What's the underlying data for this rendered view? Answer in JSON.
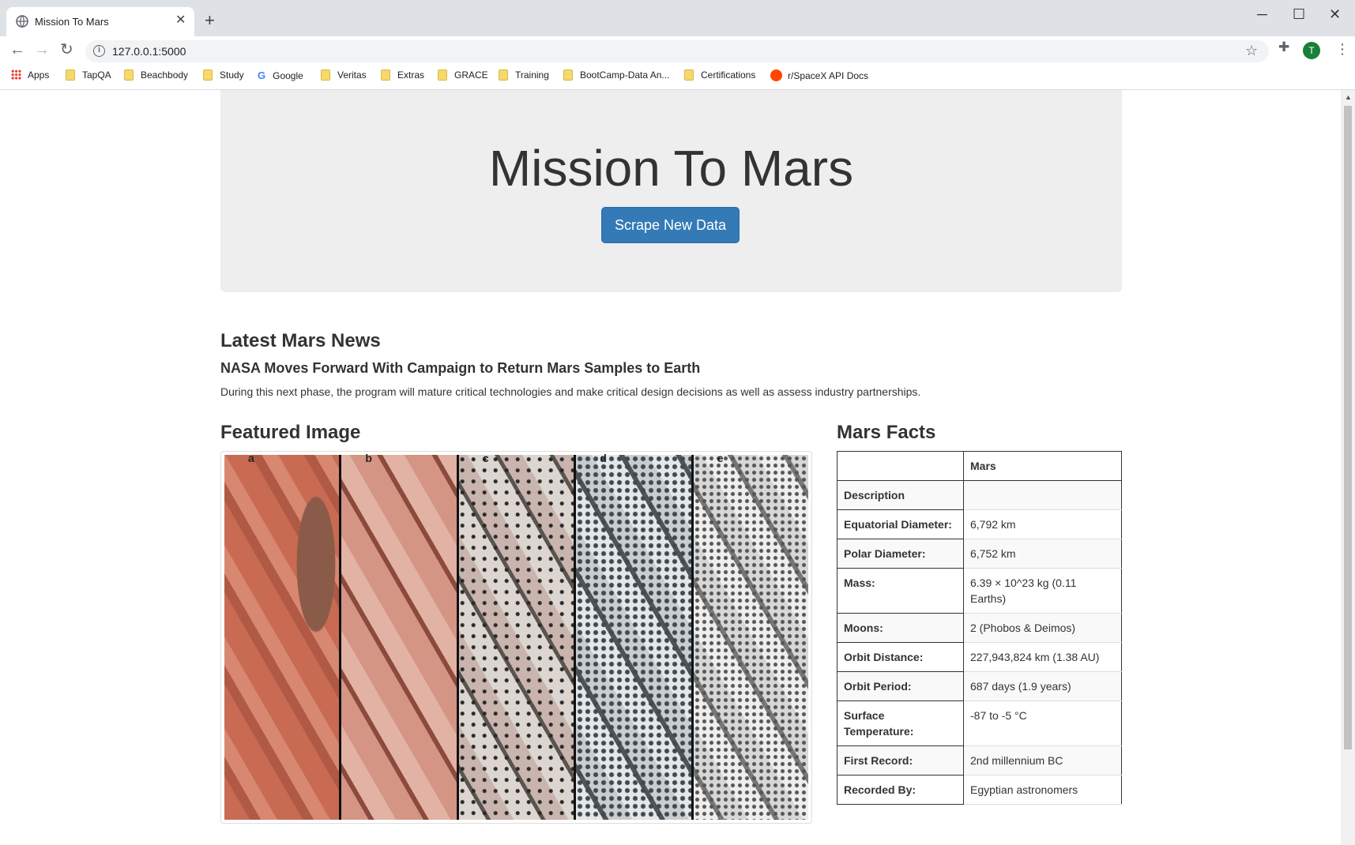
{
  "browser": {
    "tab_title": "Mission To Mars",
    "url": "127.0.0.1:5000",
    "avatar_letter": "T",
    "bookmarks": [
      {
        "label": "Apps",
        "icon": "apps-grid-icon"
      },
      {
        "label": "TapQA",
        "icon": "folder-icon"
      },
      {
        "label": "Beachbody",
        "icon": "folder-icon"
      },
      {
        "label": "Study",
        "icon": "folder-icon"
      },
      {
        "label": "Google",
        "icon": "google-icon"
      },
      {
        "label": "Veritas",
        "icon": "folder-icon"
      },
      {
        "label": "Extras",
        "icon": "folder-icon"
      },
      {
        "label": "GRACE",
        "icon": "folder-icon"
      },
      {
        "label": "Training",
        "icon": "folder-icon"
      },
      {
        "label": "BootCamp-Data An...",
        "icon": "folder-icon"
      },
      {
        "label": "Certifications",
        "icon": "folder-icon"
      },
      {
        "label": "r/SpaceX API Docs",
        "icon": "reddit-icon"
      }
    ]
  },
  "page": {
    "title": "Mission To Mars",
    "scrape_button": "Scrape New Data",
    "news": {
      "heading": "Latest Mars News",
      "title": "NASA Moves Forward With Campaign to Return Mars Samples to Earth",
      "paragraph": "During this next phase, the program will mature critical technologies and make critical design decisions as well as assess industry partnerships."
    },
    "featured_image": {
      "heading": "Featured Image",
      "panel_labels": [
        "a",
        "b",
        "c",
        "d",
        "e"
      ]
    },
    "facts": {
      "heading": "Mars Facts",
      "header": [
        "",
        "Mars"
      ],
      "rows": [
        [
          "Description",
          ""
        ],
        [
          "Equatorial Diameter:",
          "6,792 km"
        ],
        [
          "Polar Diameter:",
          "6,752 km"
        ],
        [
          "Mass:",
          "6.39 × 10^23 kg (0.11 Earths)"
        ],
        [
          "Moons:",
          "2 (Phobos & Deimos)"
        ],
        [
          "Orbit Distance:",
          "227,943,824 km (1.38 AU)"
        ],
        [
          "Orbit Period:",
          "687 days (1.9 years)"
        ],
        [
          "Surface Temperature:",
          "-87 to -5 °C"
        ],
        [
          "First Record:",
          "2nd millennium BC"
        ],
        [
          "Recorded By:",
          "Egyptian astronomers"
        ]
      ]
    }
  }
}
